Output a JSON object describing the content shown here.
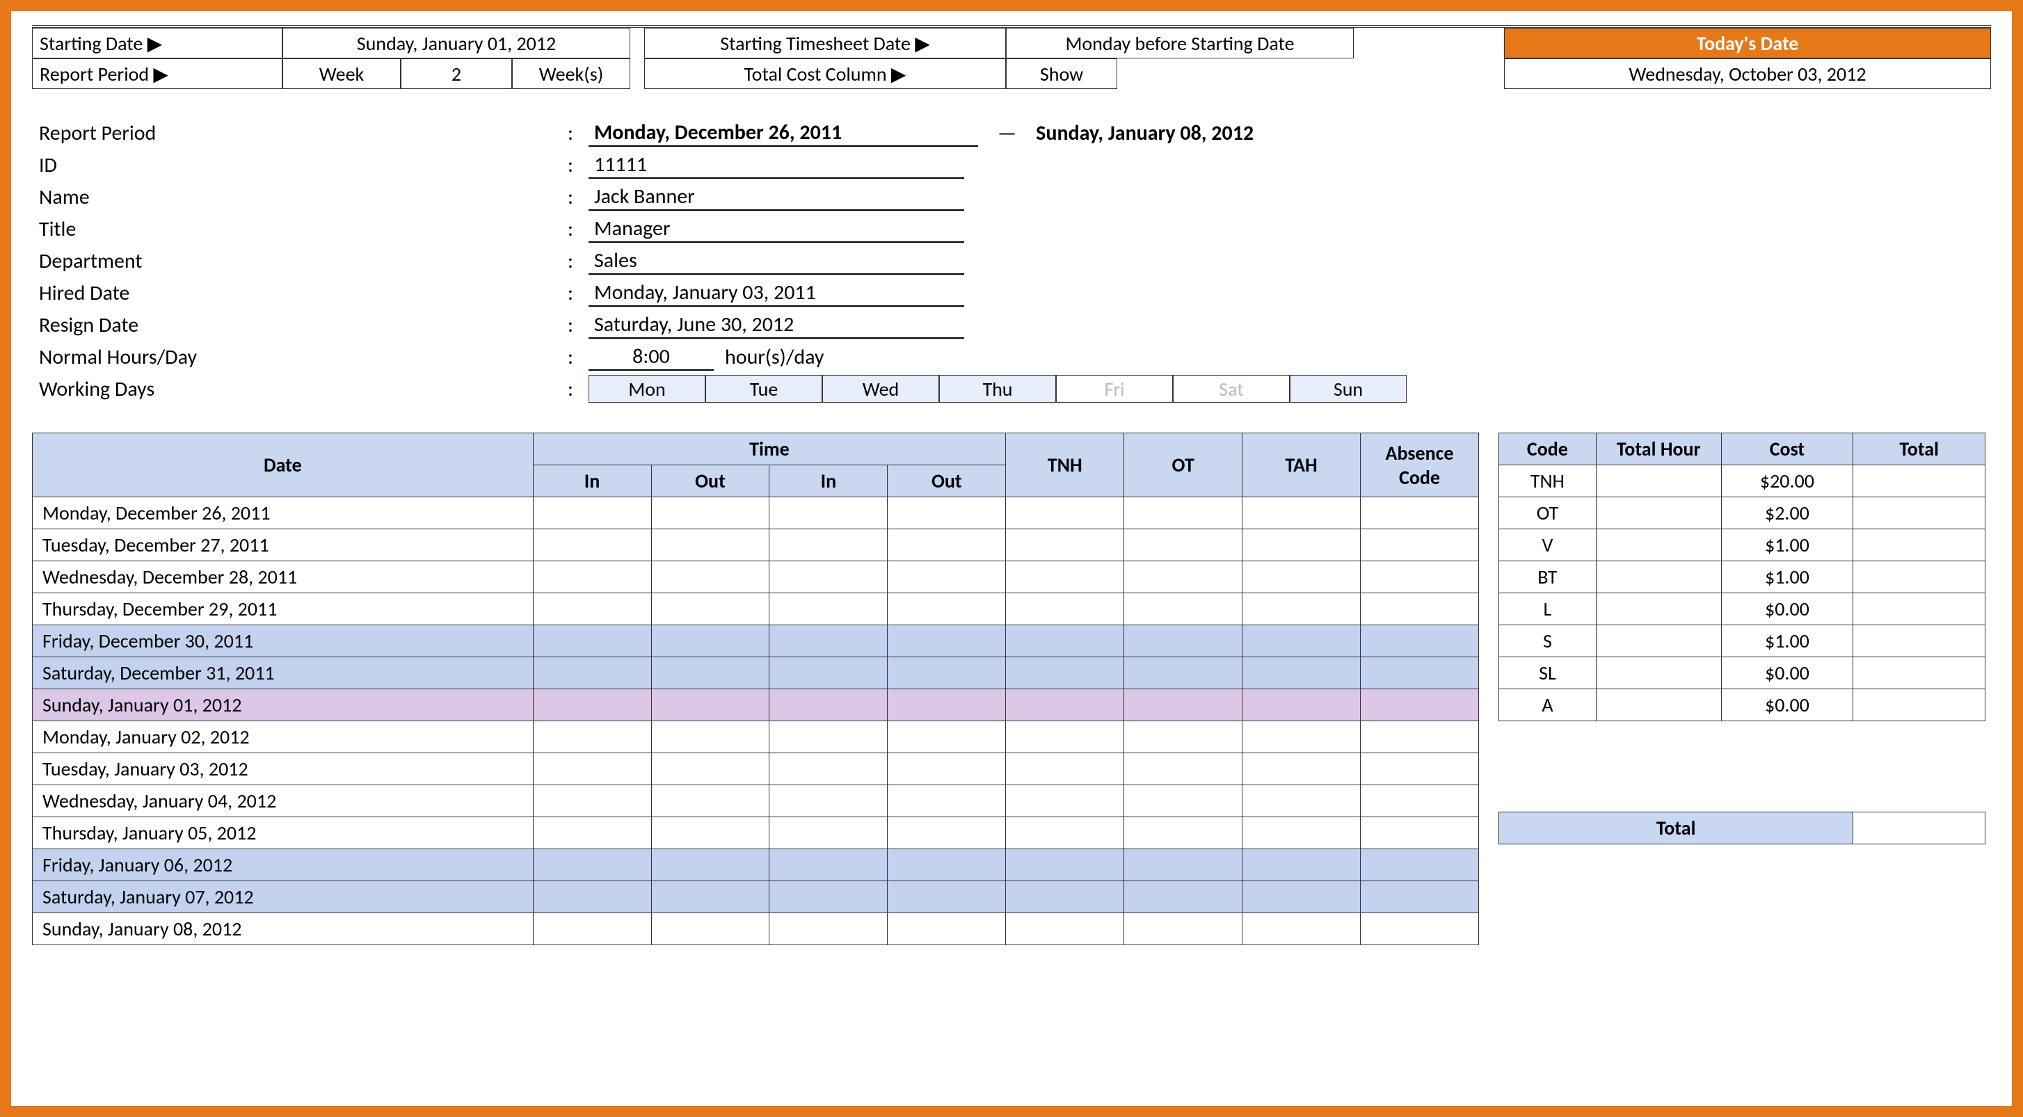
{
  "config": {
    "starting_date_label": "Starting Date ▶",
    "starting_date_value": "Sunday, January 01, 2012",
    "starting_ts_label": "Starting Timesheet Date ▶",
    "starting_ts_value": "Monday before Starting Date",
    "todays_date_label": "Today's Date",
    "report_period_label": "Report Period ▶",
    "report_period_unit": "Week",
    "report_period_count": "2",
    "report_period_weeks": "Week(s)",
    "total_cost_label": "Total Cost Column ▶",
    "total_cost_value": "Show",
    "todays_date_value": "Wednesday, October 03, 2012"
  },
  "info": {
    "report_period_label": "Report Period",
    "period_start": "Monday, December 26, 2011",
    "period_end": "Sunday, January 08, 2012",
    "id_label": "ID",
    "id_value": "11111",
    "name_label": "Name",
    "name_value": "Jack Banner",
    "title_label": "Title",
    "title_value": "Manager",
    "dept_label": "Department",
    "dept_value": "Sales",
    "hired_label": "Hired Date",
    "hired_value": "Monday, January 03, 2011",
    "resign_label": "Resign Date",
    "resign_value": "Saturday, June 30, 2012",
    "hours_label": "Normal Hours/Day",
    "hours_value": "8:00",
    "hours_unit": "hour(s)/day",
    "working_days_label": "Working Days",
    "days": [
      "Mon",
      "Tue",
      "Wed",
      "Thu",
      "Fri",
      "Sat",
      "Sun"
    ],
    "days_active": [
      true,
      true,
      true,
      true,
      false,
      false,
      true
    ]
  },
  "table": {
    "headers": {
      "date": "Date",
      "time": "Time",
      "in": "In",
      "out": "Out",
      "tnh": "TNH",
      "ot": "OT",
      "tah": "TAH",
      "absence": "Absence Code"
    },
    "rows": [
      {
        "date": "Monday, December 26, 2011",
        "cls": ""
      },
      {
        "date": "Tuesday, December 27, 2011",
        "cls": ""
      },
      {
        "date": "Wednesday, December 28, 2011",
        "cls": ""
      },
      {
        "date": "Thursday, December 29, 2011",
        "cls": ""
      },
      {
        "date": "Friday, December 30, 2011",
        "cls": "row-blue"
      },
      {
        "date": "Saturday, December 31, 2011",
        "cls": "row-blue"
      },
      {
        "date": "Sunday, January 01, 2012",
        "cls": "row-pink"
      },
      {
        "date": "Monday, January 02, 2012",
        "cls": ""
      },
      {
        "date": "Tuesday, January 03, 2012",
        "cls": ""
      },
      {
        "date": "Wednesday, January 04, 2012",
        "cls": ""
      },
      {
        "date": "Thursday, January 05, 2012",
        "cls": ""
      },
      {
        "date": "Friday, January 06, 2012",
        "cls": "row-blue"
      },
      {
        "date": "Saturday, January 07, 2012",
        "cls": "row-blue"
      },
      {
        "date": "Sunday, January 08, 2012",
        "cls": ""
      }
    ]
  },
  "cost_table": {
    "headers": {
      "code": "Code",
      "total_hour": "Total Hour",
      "cost": "Cost",
      "total": "Total"
    },
    "rows": [
      {
        "code": "TNH",
        "hour": "",
        "cost": "$20.00",
        "total": ""
      },
      {
        "code": "OT",
        "hour": "",
        "cost": "$2.00",
        "total": ""
      },
      {
        "code": "V",
        "hour": "",
        "cost": "$1.00",
        "total": ""
      },
      {
        "code": "BT",
        "hour": "",
        "cost": "$1.00",
        "total": ""
      },
      {
        "code": "L",
        "hour": "",
        "cost": "$0.00",
        "total": ""
      },
      {
        "code": "S",
        "hour": "",
        "cost": "$1.00",
        "total": ""
      },
      {
        "code": "SL",
        "hour": "",
        "cost": "$0.00",
        "total": ""
      },
      {
        "code": "A",
        "hour": "",
        "cost": "$0.00",
        "total": ""
      }
    ],
    "grand_total_label": "Total",
    "grand_total_value": ""
  }
}
